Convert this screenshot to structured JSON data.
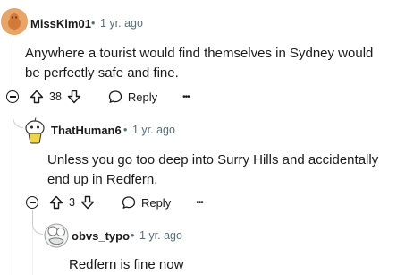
{
  "comments": [
    {
      "username": "MissKim01",
      "separator": "•",
      "age": "1 yr. ago",
      "body": "Anywhere a tourist would find themselves in Sydney would be perfectly safe and fine.",
      "votes": "38",
      "reply_label": "Reply",
      "more_label": "•••"
    },
    {
      "username": "ThatHuman6",
      "separator": "•",
      "age": "1 yr. ago",
      "body": "Unless you go too deep into Surry Hills and accidentally end up in Redfern.",
      "votes": "3",
      "reply_label": "Reply",
      "more_label": "•••"
    },
    {
      "username": "obvs_typo",
      "separator": "•",
      "age": "1 yr. ago",
      "body": "Redfern is fine now"
    }
  ],
  "colors": {
    "meta": "#576f76",
    "text": "#1a1a1b",
    "line": "#edeff1"
  },
  "icons": [
    "upvote-icon",
    "downvote-icon",
    "reply-bubble-icon",
    "collapse-icon"
  ]
}
